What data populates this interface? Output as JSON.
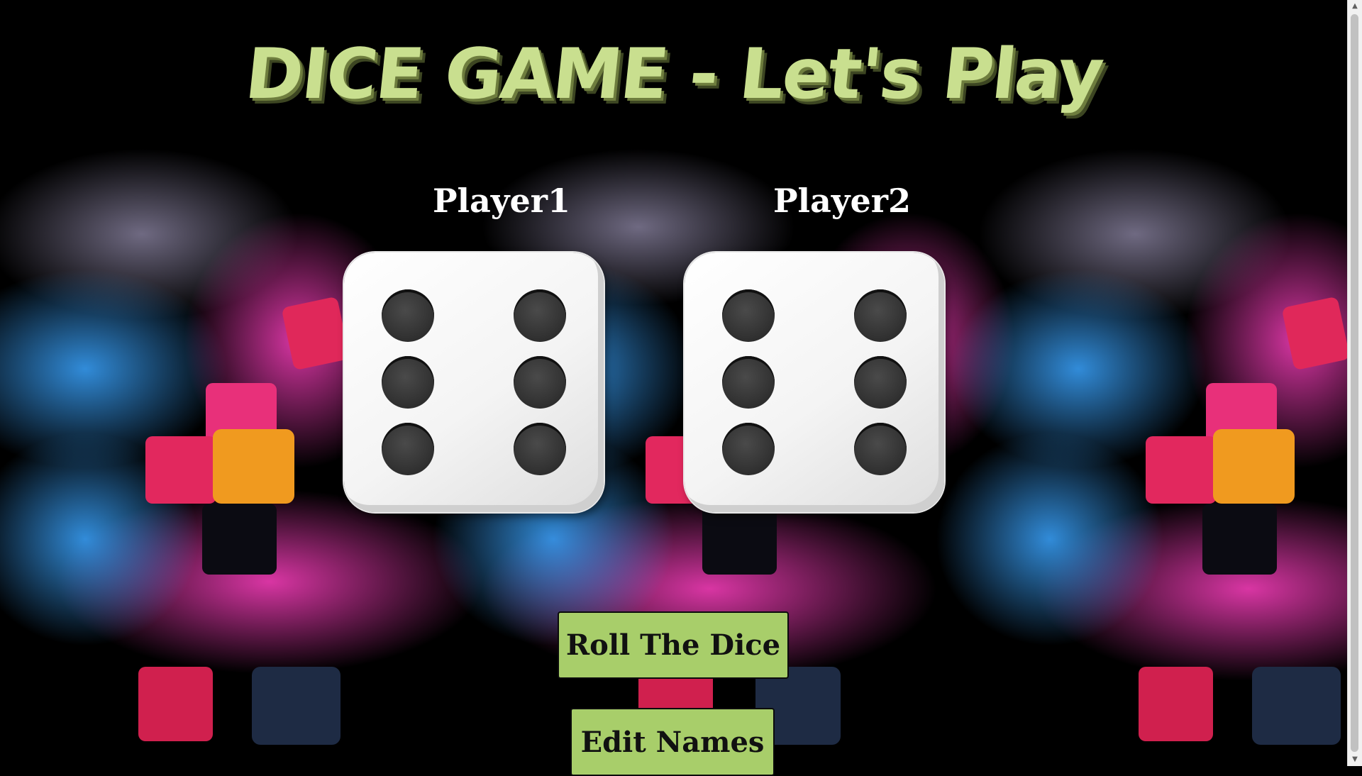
{
  "title": "DICE GAME - Let's Play",
  "players": [
    {
      "name": "Player1",
      "die_value": 6
    },
    {
      "name": "Player2",
      "die_value": 6
    }
  ],
  "buttons": {
    "roll": "Roll The Dice",
    "edit": "Edit Names"
  },
  "colors": {
    "title": "#c9df8f",
    "button": "#a8ce6a",
    "background": "#000000"
  },
  "icons": {
    "scroll_up": "chevron-up-icon",
    "scroll_down": "chevron-down-icon"
  }
}
